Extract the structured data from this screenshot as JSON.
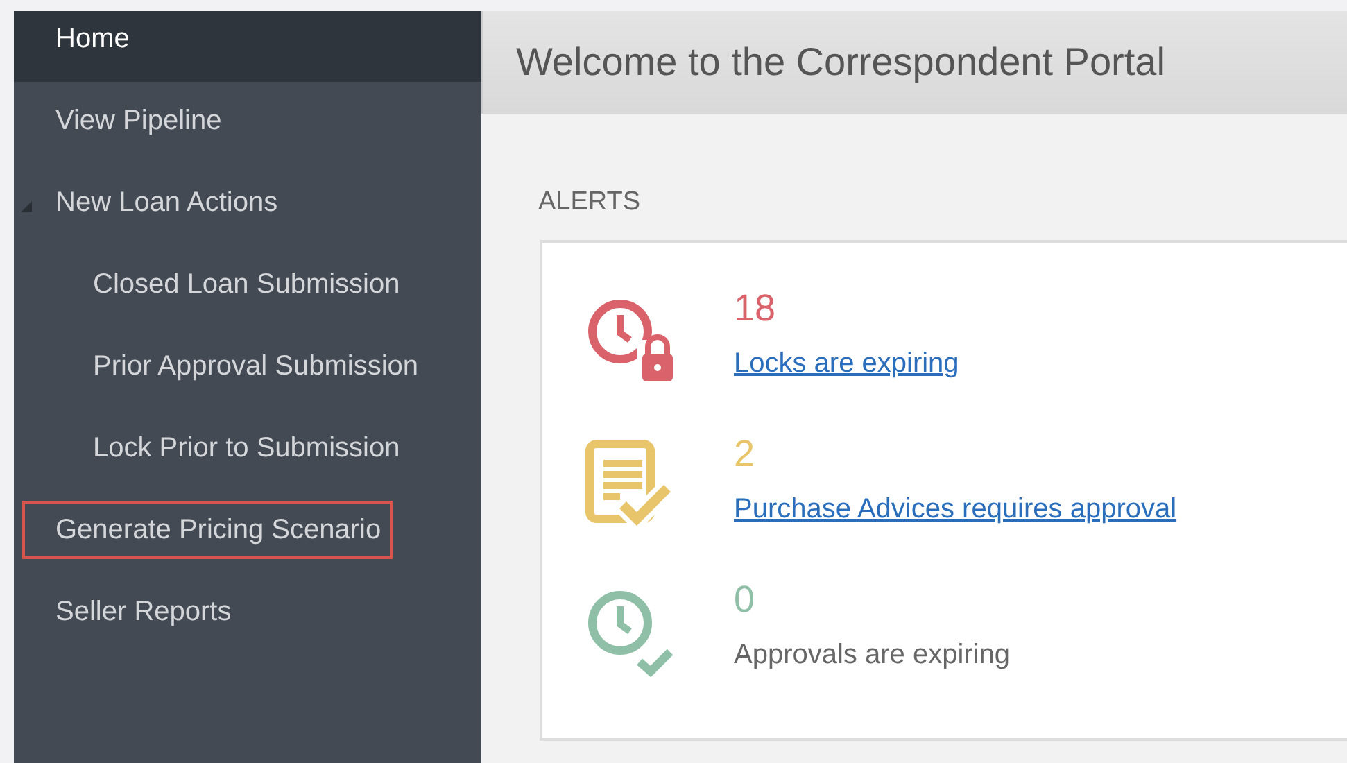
{
  "sidebar": {
    "items": [
      {
        "label": "Home",
        "selected": true,
        "highlighted": false
      },
      {
        "label": "View Pipeline",
        "selected": false,
        "highlighted": false
      },
      {
        "label": "New Loan Actions",
        "selected": false,
        "highlighted": false,
        "expanded": true,
        "children": [
          {
            "label": "Closed Loan Submission",
            "selected": false,
            "highlighted": false
          },
          {
            "label": "Prior Approval Submission",
            "selected": false,
            "highlighted": false
          },
          {
            "label": "Lock Prior to Submission",
            "selected": false,
            "highlighted": false
          }
        ]
      },
      {
        "label": "Generate Pricing Scenario",
        "selected": false,
        "highlighted": true
      },
      {
        "label": "Seller Reports",
        "selected": false,
        "highlighted": false
      }
    ]
  },
  "header": {
    "title": "Welcome to the Correspondent Portal"
  },
  "alerts": {
    "heading": "ALERTS",
    "items": [
      {
        "kind": "lock",
        "color": "#d9626b",
        "count": "18",
        "message": "Locks are expiring",
        "linked": true
      },
      {
        "kind": "document",
        "color": "#e8c46a",
        "count": "2",
        "message": "Purchase Advices requires approval",
        "linked": true
      },
      {
        "kind": "clock",
        "color": "#8fbfa6",
        "count": "0",
        "message": "Approvals are expiring",
        "linked": false
      }
    ]
  }
}
